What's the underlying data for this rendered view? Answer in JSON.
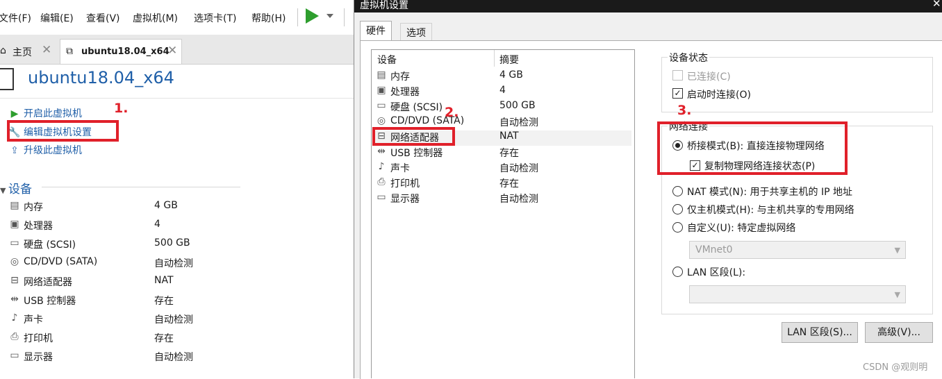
{
  "menu": [
    "文件(F)",
    "编辑(E)",
    "查看(V)",
    "虚拟机(M)",
    "选项卡(T)",
    "帮助(H)"
  ],
  "tabs": {
    "home": "主页",
    "vm": "ubuntu18.04_x64",
    "close": "✕"
  },
  "vm_title": "ubuntu18.04_x64",
  "actions": [
    "开启此虚拟机",
    "编辑虚拟机设置",
    "升级此虚拟机"
  ],
  "devices_header": "设备",
  "devices": [
    {
      "name": "内存",
      "value": "4 GB",
      "icon": "memory-icon"
    },
    {
      "name": "处理器",
      "value": "4",
      "icon": "cpu-icon"
    },
    {
      "name": "硬盘 (SCSI)",
      "value": "500 GB",
      "icon": "harddisk-icon"
    },
    {
      "name": "CD/DVD (SATA)",
      "value": "自动检测",
      "icon": "cd-icon"
    },
    {
      "name": "网络适配器",
      "value": "NAT",
      "icon": "network-icon"
    },
    {
      "name": "USB 控制器",
      "value": "存在",
      "icon": "usb-icon"
    },
    {
      "name": "声卡",
      "value": "自动检测",
      "icon": "sound-icon"
    },
    {
      "name": "打印机",
      "value": "存在",
      "icon": "printer-icon"
    },
    {
      "name": "显示器",
      "value": "自动检测",
      "icon": "display-icon"
    }
  ],
  "dialog": {
    "title": "虚拟机设置",
    "close": "✕",
    "tabs": [
      "硬件",
      "选项"
    ],
    "list_headers": {
      "device": "设备",
      "summary": "摘要"
    },
    "hardware": [
      {
        "name": "内存",
        "value": "4 GB"
      },
      {
        "name": "处理器",
        "value": "4"
      },
      {
        "name": "硬盘 (SCSI)",
        "value": "500 GB"
      },
      {
        "name": "CD/DVD (SATA)",
        "value": "自动检测"
      },
      {
        "name": "网络适配器",
        "value": "NAT"
      },
      {
        "name": "USB 控制器",
        "value": "存在"
      },
      {
        "name": "声卡",
        "value": "自动检测"
      },
      {
        "name": "打印机",
        "value": "存在"
      },
      {
        "name": "显示器",
        "value": "自动检测"
      }
    ],
    "device_status": {
      "title": "设备状态",
      "connected": "已连接(C)",
      "connect_on_start": "启动时连接(O)"
    },
    "network": {
      "title": "网络连接",
      "bridged": "桥接模式(B): 直接连接物理网络",
      "replicate": "复制物理网络连接状态(P)",
      "nat": "NAT 模式(N): 用于共享主机的 IP 地址",
      "hostonly": "仅主机模式(H): 与主机共享的专用网络",
      "custom": "自定义(U): 特定虚拟网络",
      "vmnet_value": "VMnet0",
      "lan": "LAN 区段(L):",
      "lan_value": ""
    },
    "buttons": {
      "lan_segments": "LAN 区段(S)...",
      "advanced": "高级(V)..."
    }
  },
  "annotations": [
    "1.",
    "2.",
    "3."
  ],
  "watermark": "CSDN @观则明",
  "colors": {
    "accent_link": "#1f5fa8",
    "annotation_red": "#e0202a",
    "play_green": "#2e9e2e"
  }
}
